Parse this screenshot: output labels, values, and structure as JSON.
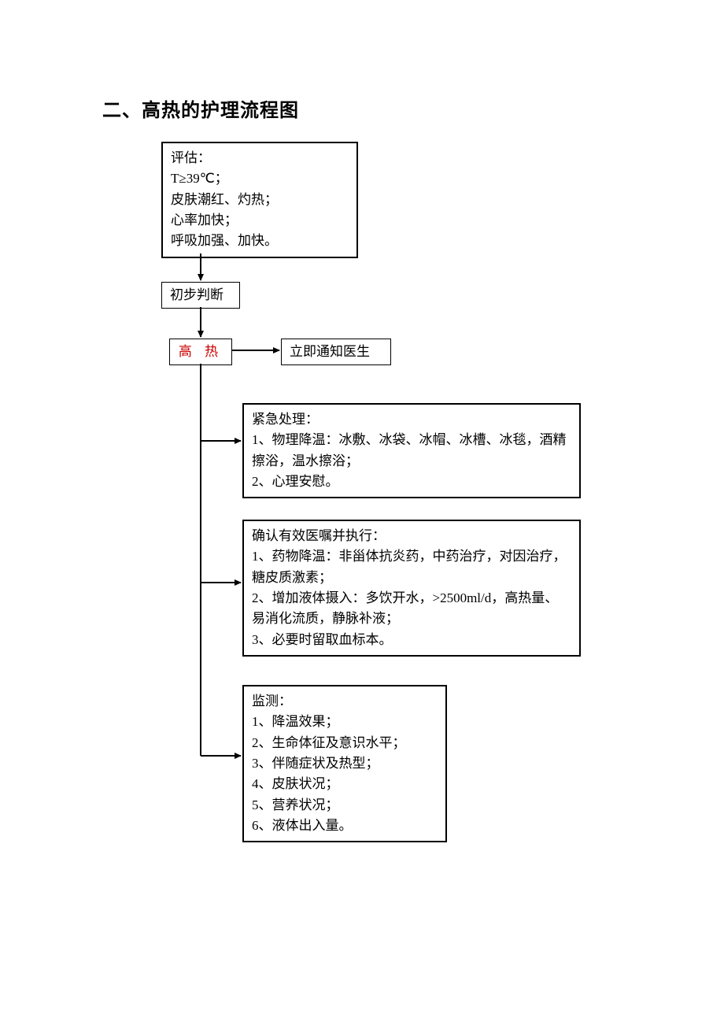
{
  "title": "二、高热的护理流程图",
  "nodes": {
    "assess": {
      "header": "评估：",
      "items": [
        "  T≥39℃；",
        "皮肤潮红、灼热；",
        "心率加快；",
        "呼吸加强、加快。"
      ]
    },
    "prelim": {
      "label": "初步判断"
    },
    "highfever": {
      "label": "高 热"
    },
    "notify": {
      "label": "立即通知医生"
    },
    "emergency": {
      "header": "紧急处理：",
      "items": [
        "1、物理降温：冰敷、冰袋、冰帽、冰槽、冰毯，酒精擦浴，温水擦浴；",
        "2、心理安慰。"
      ]
    },
    "confirm": {
      "header": "确认有效医嘱并执行：",
      "items": [
        "1、药物降温：非甾体抗炎药，中药治疗，对因治疗，糖皮质激素；",
        "2、增加液体摄入：多饮开水，>2500ml/d，高热量、易消化流质，静脉补液；",
        "3、必要时留取血标本。"
      ]
    },
    "monitor": {
      "header": "监测：",
      "items": [
        "1、降温效果；",
        "2、生命体征及意识水平；",
        "3、伴随症状及热型；",
        "4、皮肤状况；",
        "5、营养状况；",
        "6、液体出入量。"
      ]
    }
  }
}
